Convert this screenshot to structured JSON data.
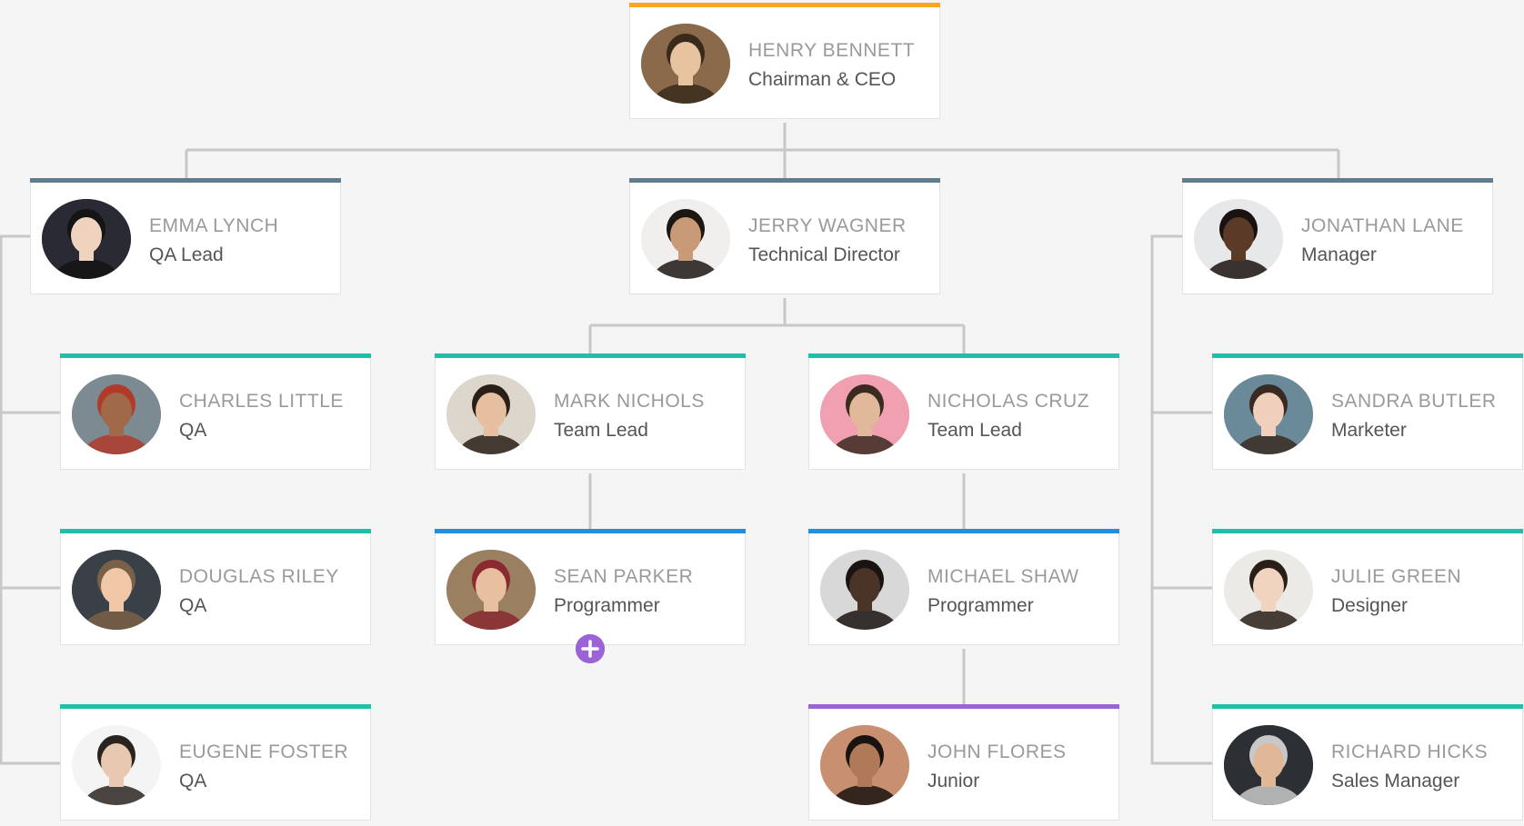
{
  "colors": {
    "background": "#f5f5f5",
    "connector": "#c8c8c8",
    "ceo_accent": "#f5a623",
    "executive_accent": "#5f7d8c",
    "staff_accent": "#1ec0a8",
    "developer_accent": "#1e90e0",
    "junior_accent": "#9b63d6",
    "add_button": "#9b63d6"
  },
  "people": [
    {
      "id": "henry",
      "name": "HENRY BENNETT",
      "role": "Chairman & CEO",
      "accent": "#f5a623",
      "avatar_bg": "#8a6a4a",
      "skin": "#e8c3a0",
      "hair": "#3a2a1c"
    },
    {
      "id": "emma",
      "name": "EMMA LYNCH",
      "role": "QA Lead",
      "accent": "#5f7d8c",
      "avatar_bg": "#2a2a35",
      "skin": "#f0d3bf",
      "hair": "#141414"
    },
    {
      "id": "jerry",
      "name": "JERRY WAGNER",
      "role": "Technical Director",
      "accent": "#5f7d8c",
      "avatar_bg": "#f0efed",
      "skin": "#c99a78",
      "hair": "#1d1712"
    },
    {
      "id": "jonathan",
      "name": "JONATHAN LANE",
      "role": "Manager",
      "accent": "#5f7d8c",
      "avatar_bg": "#e6e8ea",
      "skin": "#5b3a28",
      "hair": "#1a1210"
    },
    {
      "id": "charles",
      "name": "CHARLES LITTLE",
      "role": "QA",
      "accent": "#1ec0a8",
      "avatar_bg": "#7c8a92",
      "skin": "#a06a4a",
      "hair": "#b23a2a"
    },
    {
      "id": "mark",
      "name": "MARK NICHOLS",
      "role": "Team Lead",
      "accent": "#1ec0a8",
      "avatar_bg": "#dcd6cc",
      "skin": "#e6bfa0",
      "hair": "#2a1f16"
    },
    {
      "id": "nicholas",
      "name": "NICHOLAS CRUZ",
      "role": "Team Lead",
      "accent": "#1ec0a8",
      "avatar_bg": "#f0a0b0",
      "skin": "#e0b89a",
      "hair": "#3b2a20"
    },
    {
      "id": "sandra",
      "name": "SANDRA BUTLER",
      "role": "Marketer",
      "accent": "#1ec0a8",
      "avatar_bg": "#6a8a9a",
      "skin": "#f0d0bc",
      "hair": "#3a2a22"
    },
    {
      "id": "douglas",
      "name": "DOUGLAS RILEY",
      "role": "QA",
      "accent": "#1ec0a8",
      "avatar_bg": "#3a4048",
      "skin": "#f0c8a8",
      "hair": "#7a6048"
    },
    {
      "id": "sean",
      "name": "SEAN PARKER",
      "role": "Programmer",
      "accent": "#1e90e0",
      "avatar_bg": "#9a8060",
      "skin": "#e8c0a0",
      "hair": "#8a2a30"
    },
    {
      "id": "michael",
      "name": "MICHAEL SHAW",
      "role": "Programmer",
      "accent": "#1e90e0",
      "avatar_bg": "#d8d8d8",
      "skin": "#4a3428",
      "hair": "#1a1410"
    },
    {
      "id": "julie",
      "name": "JULIE GREEN",
      "role": "Designer",
      "accent": "#1ec0a8",
      "avatar_bg": "#eceae6",
      "skin": "#f0d4c0",
      "hair": "#2a1f18"
    },
    {
      "id": "eugene",
      "name": "EUGENE FOSTER",
      "role": "QA",
      "accent": "#1ec0a8",
      "avatar_bg": "#f4f4f4",
      "skin": "#e8c8b0",
      "hair": "#2a2420"
    },
    {
      "id": "john",
      "name": "JOHN FLORES",
      "role": "Junior",
      "accent": "#9b63d6",
      "avatar_bg": "#c89070",
      "skin": "#b07a58",
      "hair": "#1a1410"
    },
    {
      "id": "richard",
      "name": "RICHARD HICKS",
      "role": "Sales Manager",
      "accent": "#1ec0a8",
      "avatar_bg": "#2c3034",
      "skin": "#e0b898",
      "hair": "#c8c8c8"
    }
  ],
  "add_button": {
    "icon": "plus-icon",
    "attached_to": "sean"
  }
}
